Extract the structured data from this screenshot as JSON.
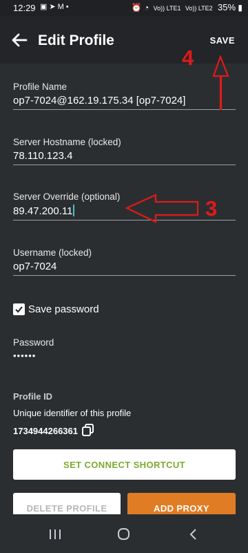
{
  "status_bar": {
    "time": "12:29",
    "notif_icons": [
      "gallery-icon",
      "telegram-icon",
      "gmail-icon",
      "dot-icon"
    ],
    "signal_label_1": "Vo)) LTE1",
    "signal_label_2": "Vo)) LTE2",
    "battery": "35%"
  },
  "app_bar": {
    "title": "Edit Profile",
    "save_label": "SAVE"
  },
  "fields": {
    "profile_name": {
      "label": "Profile Name",
      "value": "op7-7024@162.19.175.34 [op7-7024]"
    },
    "server_hostname": {
      "label": "Server Hostname (locked)",
      "value": "78.110.123.4"
    },
    "server_override": {
      "label": "Server Override (optional)",
      "value": "89.47.200.11"
    },
    "username": {
      "label": "Username (locked)",
      "value": "op7-7024"
    },
    "save_password": {
      "label": "Save password",
      "checked": true
    },
    "password": {
      "label": "Password",
      "value": "••••••"
    }
  },
  "profile_id": {
    "heading": "Profile ID",
    "description": "Unique identifier of this profile",
    "value": "1734944266361"
  },
  "buttons": {
    "connect_shortcut": "SET CONNECT SHORTCUT",
    "delete_profile": "DELETE PROFILE",
    "add_proxy": "ADD PROXY"
  },
  "annotations": {
    "save_step": "4",
    "override_step": "3",
    "color": "#e01a1a"
  },
  "colors": {
    "background": "#2b2e31",
    "accent_orange": "#e07d24",
    "accent_green": "#7aaa2f",
    "cursor": "#45c4c4"
  }
}
